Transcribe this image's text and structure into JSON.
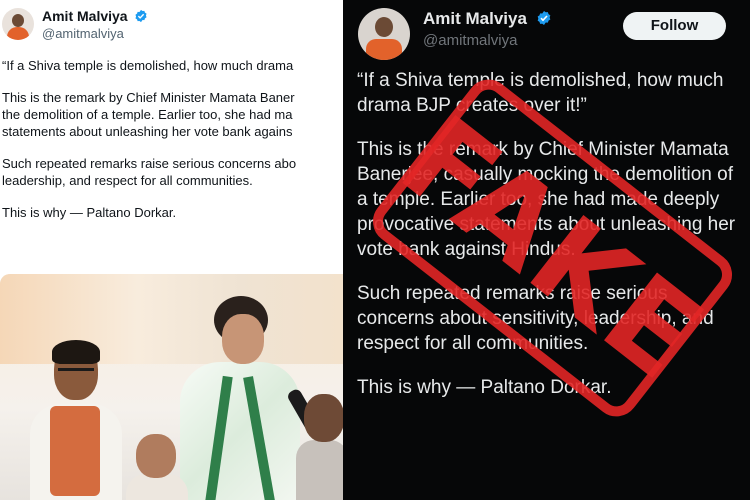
{
  "left_tweet": {
    "author_name": "Amit Malviya",
    "handle": "@amitmalviya",
    "lines": [
      "“If a Shiva temple is demolished, how much drama",
      "This is the remark by Chief Minister Mamata Baner",
      "the demolition of a temple. Earlier too, she had ma",
      "statements about unleashing her vote bank agains",
      "Such repeated remarks raise serious concerns abo",
      "leadership, and respect for all communities.",
      "This is why — Paltano Dorkar."
    ]
  },
  "right_tweet": {
    "author_name": "Amit Malviya",
    "handle": "@amitmalviya",
    "follow_label": "Follow",
    "paragraphs": [
      "“If a Shiva temple is demolished, how much drama BJP creates over it!”",
      "This is the remark by Chief Minister Mamata Banerjee, casually mocking the demolition of a temple. Earlier too, she had made deeply provocative statements about unleashing her vote bank against Hindus.",
      "Such repeated remarks raise serious concerns about sensitivity, leadership, and respect for all communities.",
      "This is why — Paltano Dorkar."
    ]
  },
  "stamp": {
    "text": "FAKE",
    "color": "#e22626"
  },
  "colors": {
    "verified_blue": "#1d9bf0",
    "dark_bg": "#060708",
    "light_text": "#0f1419"
  },
  "icons": [
    "verified-badge-icon"
  ]
}
